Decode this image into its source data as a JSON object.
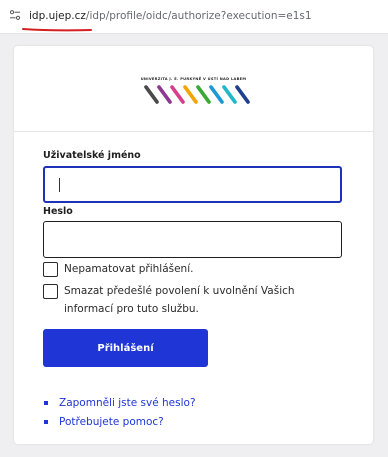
{
  "browser": {
    "url_host": "idp.ujep.cz",
    "url_path": "/idp/profile/oidc/authorize?execution=e1s1",
    "site_icon": "site-settings-icon"
  },
  "brand": {
    "university_name": "UNIVERZITA J. E. PURKYNĚ V ÚSTÍ NAD LABEM",
    "stripe_colors": [
      "#4a4a4a",
      "#8c3a8f",
      "#d63f8c",
      "#f0a500",
      "#3aaa35",
      "#1d9ad6",
      "#20b8c8",
      "#1f3f8f"
    ]
  },
  "form": {
    "username_label": "Uživatelské jméno",
    "username_value": "",
    "password_label": "Heslo",
    "password_value": "",
    "dont_remember_label": "Nepamatovat přihlášení.",
    "clear_consent_line1": "Smazat předešlé povolení k uvolnění Vašich",
    "clear_consent_line2": "informací pro tuto službu.",
    "login_button": "Přihlášení"
  },
  "links": {
    "forgot_password": "Zapomněli jste své heslo?",
    "need_help": "Potřebujete pomoc?"
  },
  "colors": {
    "accent": "#1f35d6",
    "focus_border": "#1d32b8",
    "annotation_underline": "#d42020"
  }
}
